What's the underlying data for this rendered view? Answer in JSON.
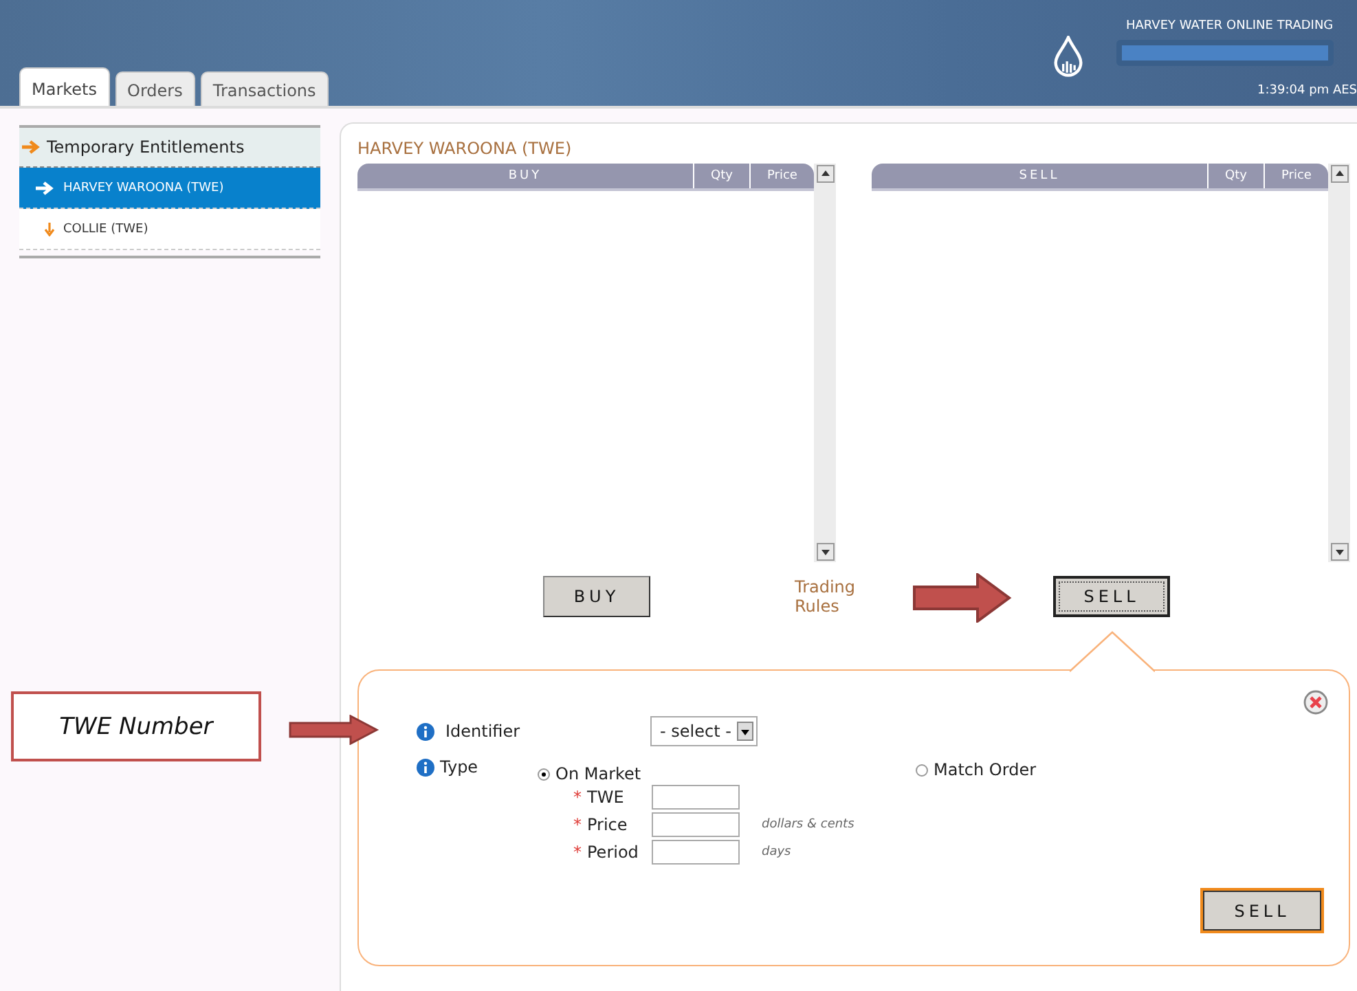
{
  "header": {
    "title": "HARVEY WATER ONLINE TRADING",
    "time": "1:39:04 pm AES"
  },
  "tabs": [
    {
      "label": "Markets",
      "selected": true
    },
    {
      "label": "Orders",
      "selected": false
    },
    {
      "label": "Transactions",
      "selected": false
    }
  ],
  "sidebar": {
    "heading": "Temporary Entitlements",
    "items": [
      {
        "label": "HARVEY WAROONA (TWE)",
        "selected": true
      },
      {
        "label": "COLLIE (TWE)",
        "selected": false
      }
    ]
  },
  "market_title": "HARVEY WAROONA (TWE)",
  "tables": [
    {
      "columns": [
        "BUY",
        "Qty",
        "Price"
      ]
    },
    {
      "columns": [
        "SELL",
        "Qty",
        "Price"
      ]
    }
  ],
  "actions": {
    "buy": "BUY",
    "trading_rules": "Trading Rules",
    "sell": "SELL"
  },
  "form": {
    "identifier_label": "Identifier",
    "identifier_select": "- select -",
    "type_label": "Type",
    "options": [
      {
        "label": "On Market",
        "selected": true
      },
      {
        "label": "Match Order",
        "selected": false
      }
    ],
    "fields": [
      {
        "marker": "*",
        "label": "TWE"
      },
      {
        "marker": "*",
        "label": "Price",
        "unit": "dollars & cents"
      },
      {
        "marker": "*",
        "label": "Period",
        "unit": "days"
      }
    ],
    "submit": "SELL"
  },
  "annotation": "TWE Number"
}
